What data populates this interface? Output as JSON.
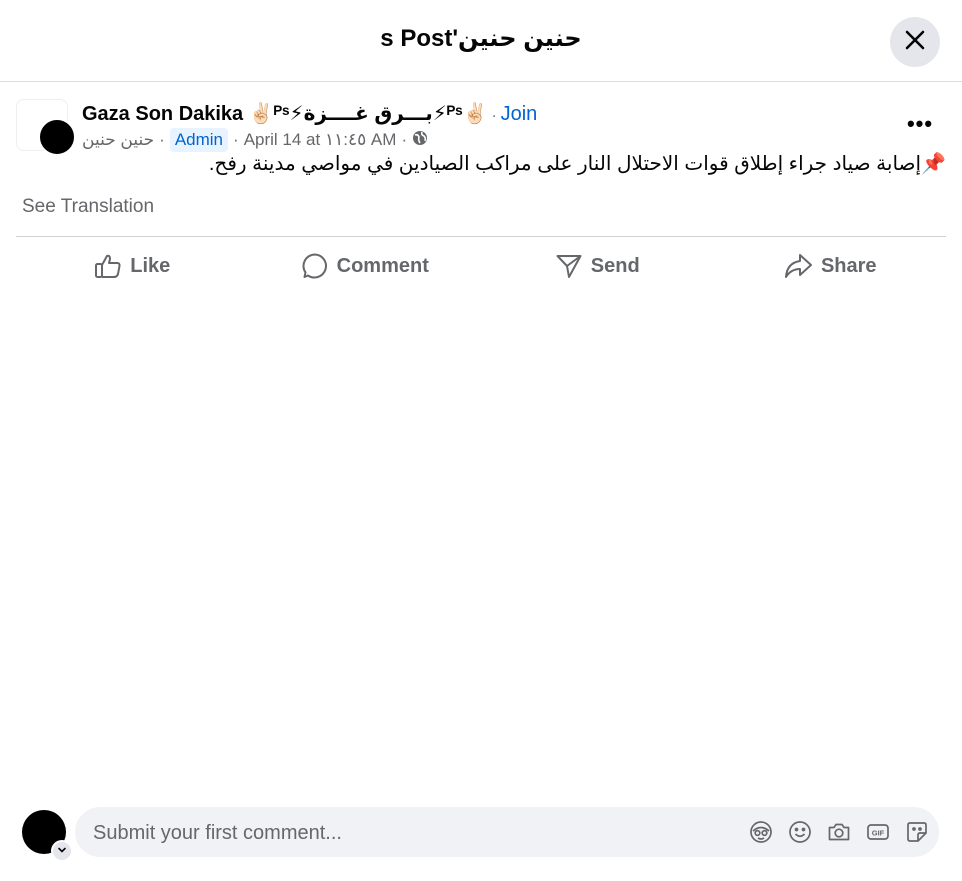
{
  "dialog": {
    "title": "حنين حنين's Post"
  },
  "post": {
    "group_name": "Gaza Son Dakika ✌🏻ᴾˢ⚡بـــرق غــــزة⚡ᴾˢ✌🏻",
    "join_label": "Join",
    "author": "حنين حنين",
    "role_badge": "Admin",
    "timestamp": "April 14 at ١١:٤٥ AM",
    "audience_icon": "globe-icon",
    "text": "📌إصابة صياد جراء إطلاق قوات الاحتلال النار على مراكب الصيادين في مواصي مدينة رفح.",
    "see_translation": "See Translation",
    "more_label": "•••"
  },
  "actions": [
    {
      "label": "Like",
      "icon": "like-icon"
    },
    {
      "label": "Comment",
      "icon": "comment-icon"
    },
    {
      "label": "Send",
      "icon": "send-icon"
    },
    {
      "label": "Share",
      "icon": "share-icon"
    }
  ],
  "composer": {
    "placeholder": "Submit your first comment...",
    "icons": [
      "avatar-sticker-icon",
      "emoji-icon",
      "camera-icon",
      "gif-icon",
      "sticker-icon"
    ]
  },
  "colors": {
    "link": "#0064d1",
    "secondary_text": "#65676b",
    "input_bg": "#f0f2f5"
  }
}
